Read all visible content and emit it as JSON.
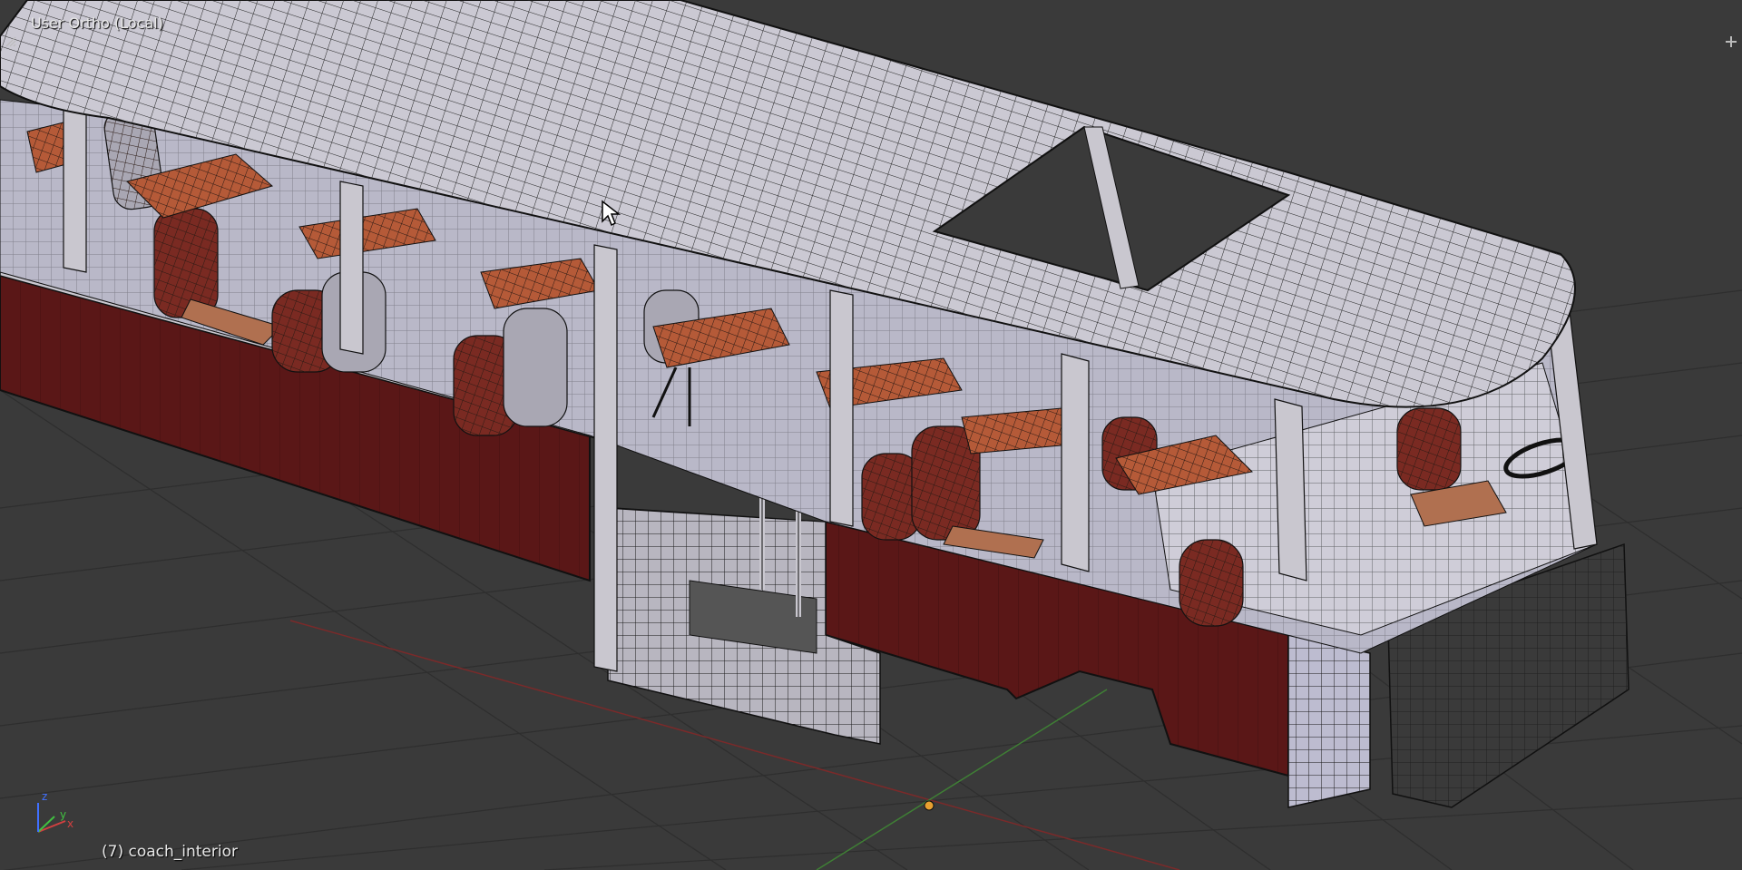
{
  "viewport": {
    "view_label": "User Ortho (Local)",
    "object_label": "(7) coach_interior",
    "colors": {
      "background": "#3a3a3a",
      "grid": "#2f2f2f",
      "x_axis": "#8a2a2a",
      "y_axis": "#4a8a3a",
      "body_red": "#5a1717",
      "body_shell": "#b8b6c0",
      "roof": "#c9c7cf",
      "wire": "#111111",
      "seat_back": "#7a2a22",
      "seat_cushion": "#b07050",
      "table_top": "#b55a38"
    },
    "axis_gizmo": {
      "x_label": "x",
      "y_label": "y",
      "z_label": "z"
    },
    "icons": [
      "split-area-left-icon",
      "split-area-right-icon",
      "mouse-cursor-icon",
      "3d-cursor-icon"
    ]
  }
}
